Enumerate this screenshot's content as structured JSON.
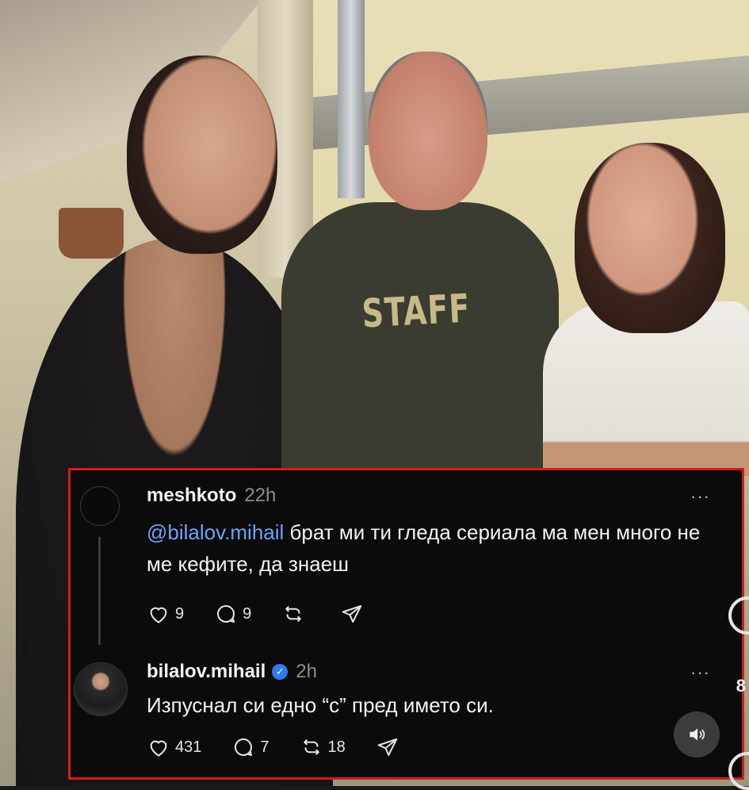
{
  "photo": {
    "shirt_text": "STAFF"
  },
  "comments": [
    {
      "username": "meshkoto",
      "time": "22h",
      "mention": "@bilalov.mihail",
      "text": " брат ми ти гледа сериала ма мен много не ме кефите, да знаеш",
      "likes": "9",
      "replies": "9",
      "reposts": "",
      "more": "···"
    },
    {
      "username": "bilalov.mihail",
      "time": "2h",
      "verified": true,
      "text": "Изпуснал си едно “с” пред името си.",
      "likes": "431",
      "replies": "7",
      "reposts": "18",
      "more": "···"
    }
  ],
  "edge_number": "8",
  "colors": {
    "panel_border": "#d21d1d",
    "mention": "#6ea2f7",
    "verified": "#2f7cf6"
  }
}
